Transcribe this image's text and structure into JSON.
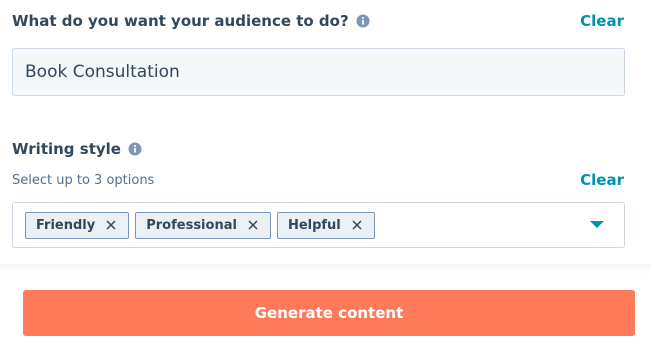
{
  "audience": {
    "label": "What do you want your audience to do?",
    "clear_label": "Clear",
    "value": "Book Consultation"
  },
  "writing_style": {
    "label": "Writing style",
    "helper": "Select up to 3 options",
    "clear_label": "Clear",
    "tags": [
      "Friendly",
      "Professional",
      "Helpful"
    ]
  },
  "generate_button": "Generate content",
  "icons": {
    "info": "info-icon",
    "remove": "close-icon",
    "dropdown": "chevron-down-icon"
  },
  "colors": {
    "accent": "#0091ae",
    "primary_button": "#ff7a59",
    "text": "#33475b"
  }
}
